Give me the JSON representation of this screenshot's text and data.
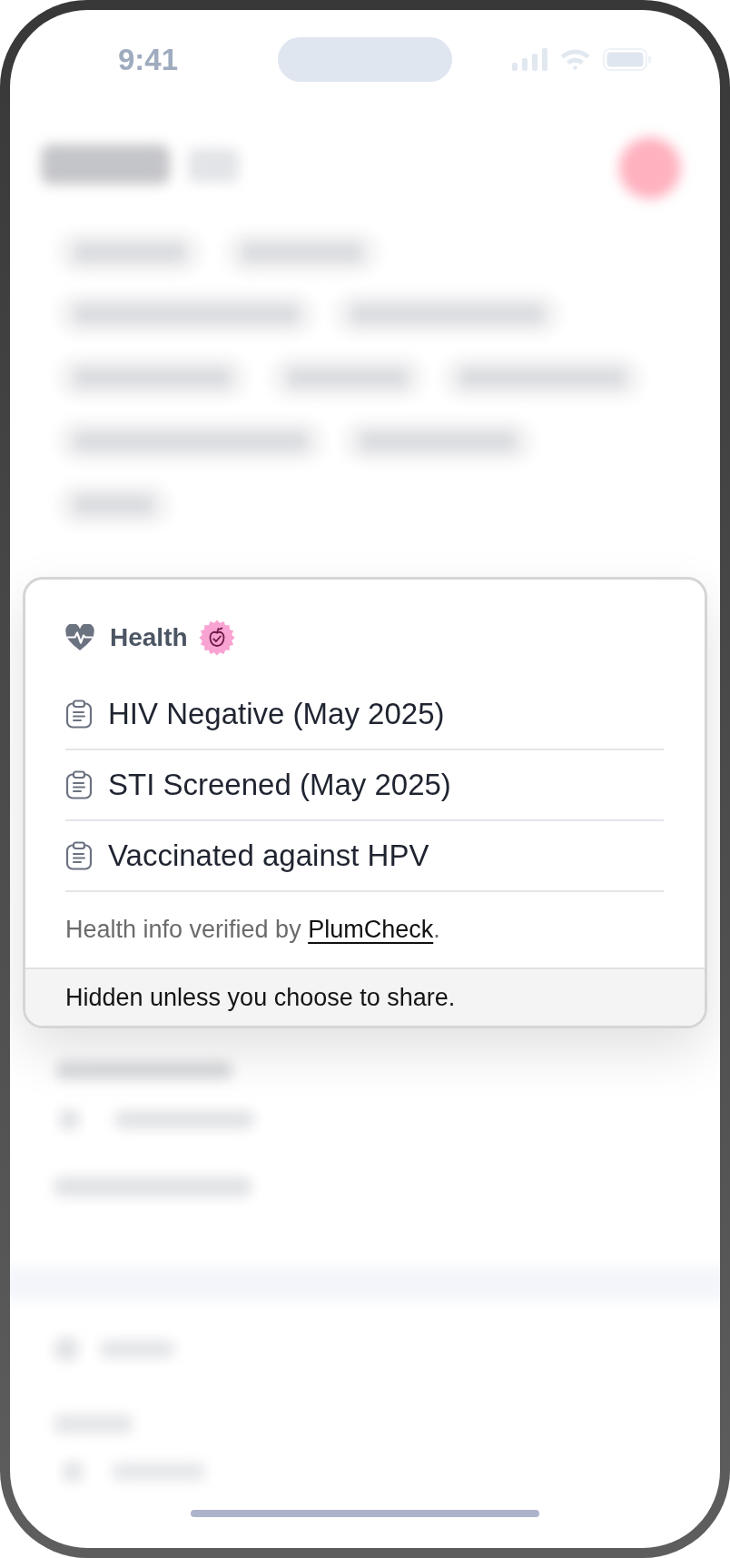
{
  "status_bar": {
    "time": "9:41"
  },
  "health_card": {
    "title": "Health",
    "items": [
      {
        "text": "HIV Negative (May 2025)"
      },
      {
        "text": "STI Screened (May 2025)"
      },
      {
        "text": "Vaccinated against HPV"
      }
    ],
    "verification": {
      "prefix": "Health info verified by",
      "link": "PlumCheck",
      "suffix": "."
    },
    "privacy_note": "Hidden unless you choose to share."
  }
}
